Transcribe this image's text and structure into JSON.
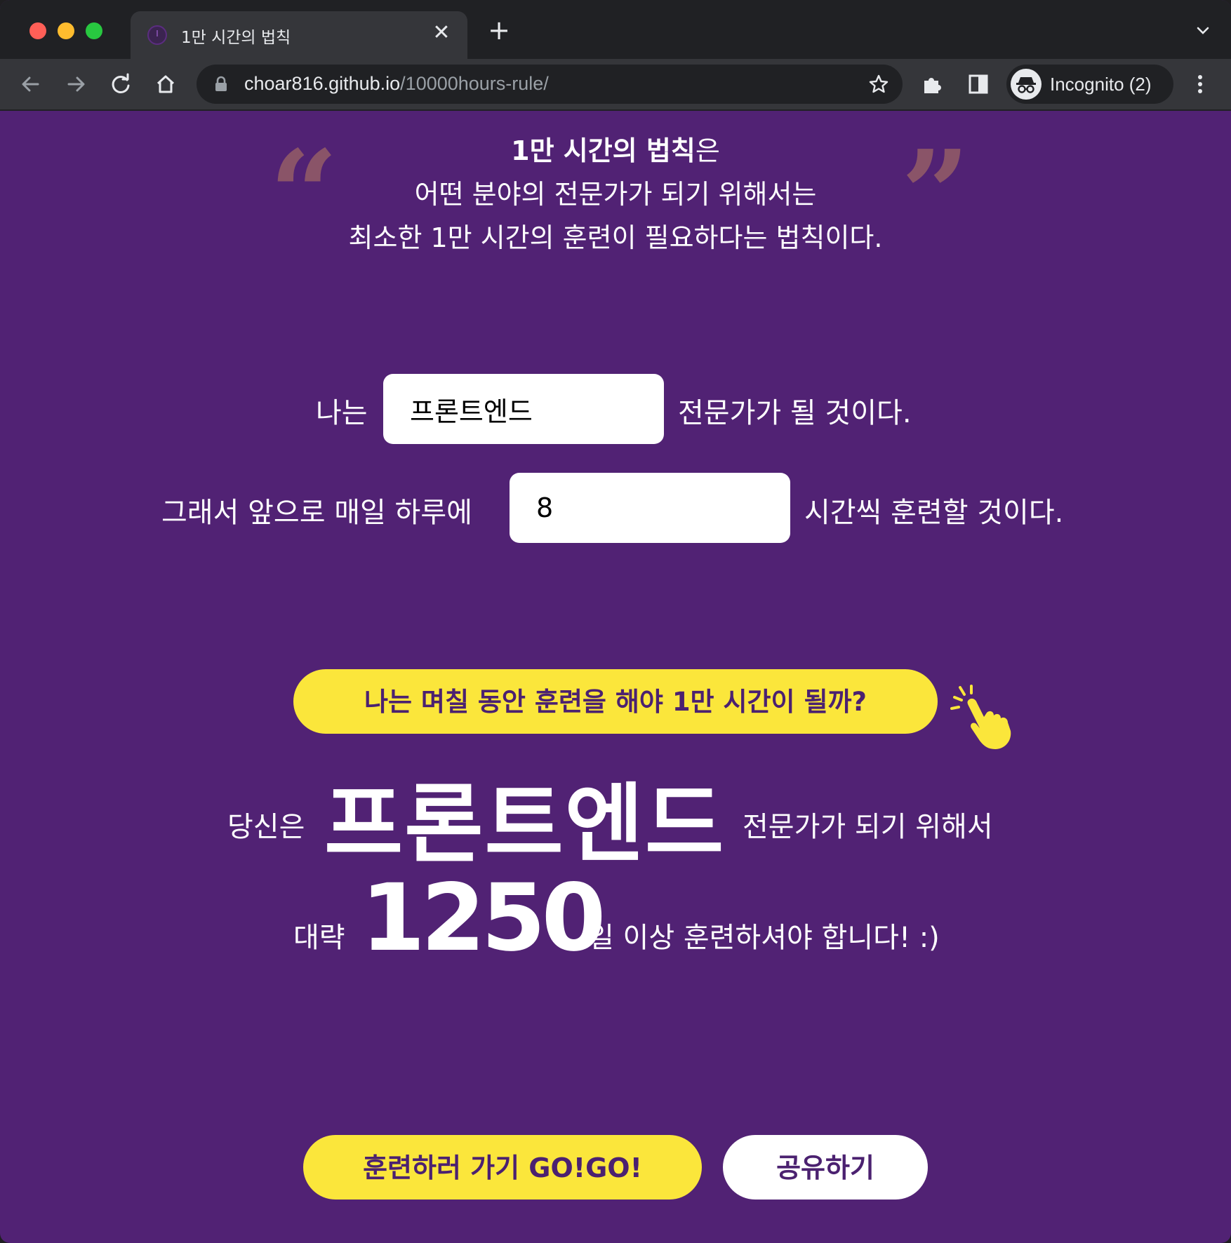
{
  "browser": {
    "tab_title": "1만 시간의 법칙",
    "url_host": "choar816.github.io",
    "url_path": "/10000hours-rule/",
    "profile_label": "Incognito (2)",
    "tab_close_glyph": "✕",
    "new_tab_glyph": "+"
  },
  "intro": {
    "title_bold": "1만 시간의 법칙",
    "title_suffix": "은",
    "line2": "어떤 분야의 전문가가 되기 위해서는",
    "line3": "최소한 1만 시간의 훈련이 필요하다는 법칙이다.",
    "quote_open": "“",
    "quote_close": "”"
  },
  "form": {
    "row1_prefix": "나는",
    "field_value": "프론트엔드",
    "row1_suffix": "전문가가 될 것이다.",
    "row2_prefix": "그래서 앞으로 매일 하루에",
    "time_value": "8",
    "row2_suffix": "시간씩 훈련할 것이다."
  },
  "calc_button": "나는 며칠 동안 훈련을 해야 1만 시간이 될까?",
  "result": {
    "prefix": "당신은",
    "field": "프론트엔드",
    "middle": "전문가가 되기 위해서",
    "approx": "대략",
    "days": "1250",
    "suffix": "일 이상 훈련하셔야 합니다! :)"
  },
  "actions": {
    "go_label": "훈련하러 가기 GO!GO!",
    "share_label": "공유하기"
  },
  "colors": {
    "page_bg": "#512274",
    "accent_yellow": "#fbe63b",
    "button_text": "#4b2170",
    "quote_mark": "#8a5468"
  },
  "icons": [
    "back-arrow-icon",
    "forward-arrow-icon",
    "reload-icon",
    "home-icon",
    "lock-icon",
    "star-icon",
    "puzzle-extension-icon",
    "side-panel-icon",
    "incognito-icon",
    "kebab-menu-icon",
    "tab-list-chevron-icon",
    "pointing-hand-icon"
  ]
}
